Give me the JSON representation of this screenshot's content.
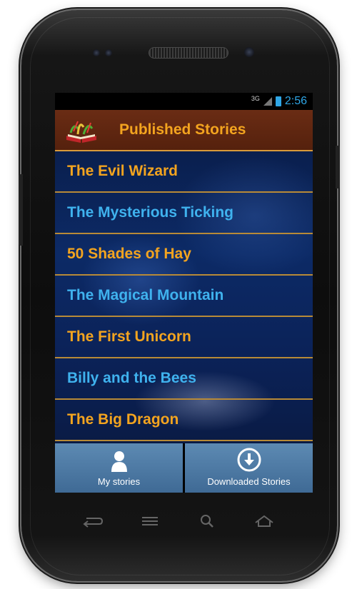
{
  "status_bar": {
    "network": "3G",
    "time": "2:56"
  },
  "header": {
    "title": "Published Stories",
    "logo_icon": "book-logo-icon"
  },
  "stories": [
    {
      "title": "The Evil Wizard",
      "color": "orange"
    },
    {
      "title": "The Mysterious Ticking",
      "color": "blue"
    },
    {
      "title": "50 Shades of Hay",
      "color": "orange"
    },
    {
      "title": "The Magical Mountain",
      "color": "blue"
    },
    {
      "title": "The First Unicorn",
      "color": "orange"
    },
    {
      "title": "Billy and the Bees",
      "color": "blue"
    },
    {
      "title": "The Big Dragon",
      "color": "orange"
    }
  ],
  "tabs": [
    {
      "label": "My stories",
      "icon": "person-icon"
    },
    {
      "label": "Downloaded Stories",
      "icon": "download-icon"
    }
  ],
  "colors": {
    "accent_orange": "#f3a41f",
    "accent_blue": "#3fb2ee",
    "header_bg": "#5e2510",
    "tab_bg": "#4a77a2"
  }
}
